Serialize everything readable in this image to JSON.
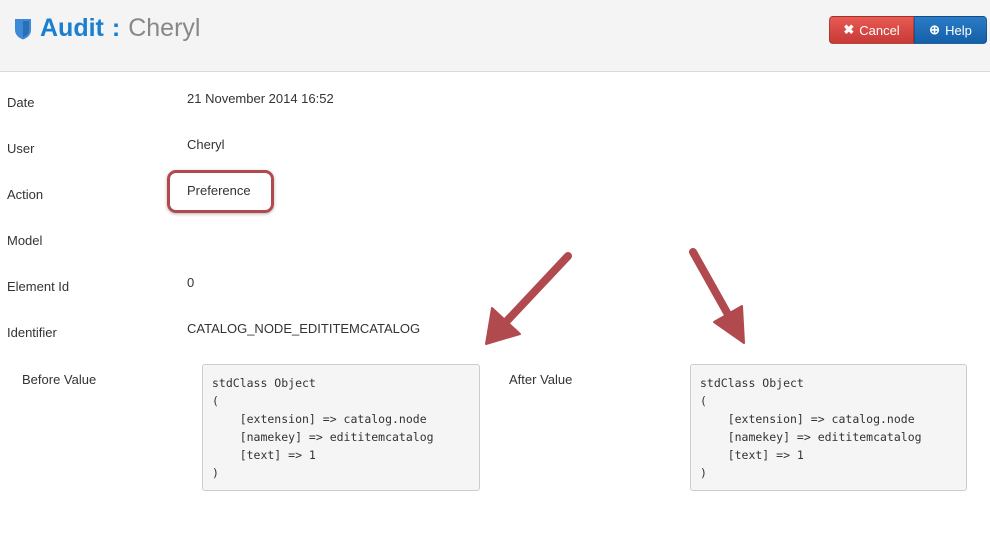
{
  "header": {
    "title": "Audit",
    "separator": ":",
    "subtitle": "Cheryl",
    "icon": "shield-icon"
  },
  "toolbar": {
    "cancel_label": "Cancel",
    "cancel_icon": "close-icon",
    "help_label": "Help",
    "help_icon": "lifebuoy-icon"
  },
  "fields": [
    {
      "label": "Date",
      "value": "21 November 2014 16:52"
    },
    {
      "label": "User",
      "value": "Cheryl"
    },
    {
      "label": "Action",
      "value": "Preference"
    },
    {
      "label": "Model",
      "value": ""
    },
    {
      "label": "Element Id",
      "value": "0"
    },
    {
      "label": "Identifier",
      "value": "CATALOG_NODE_EDITITEMCATALOG"
    }
  ],
  "before": {
    "label": "Before Value",
    "value": "stdClass Object\n(\n    [extension] => catalog.node\n    [namekey] => edititemcatalog\n    [text] => 1\n)"
  },
  "after": {
    "label": "After Value",
    "value": "stdClass Object\n(\n    [extension] => catalog.node\n    [namekey] => edititemcatalog\n    [text] => 1\n)"
  },
  "colors": {
    "accent": "#1a7fd0",
    "cancel": "#d9463f",
    "help": "#1f6fb9",
    "annotation": "#b14a4f"
  }
}
